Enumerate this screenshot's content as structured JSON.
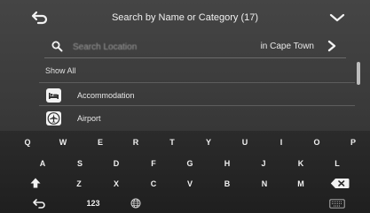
{
  "header": {
    "title": "Search by Name or Category (17)",
    "back_icon": "back-arrow-icon",
    "collapse_icon": "chevron-down-icon"
  },
  "search": {
    "placeholder": "Search Location",
    "location": "in Cape Town",
    "search_icon": "search-icon",
    "location_arrow_icon": "chevron-right-icon"
  },
  "list": {
    "show_all": "Show All",
    "items": [
      {
        "label": "Accommodation",
        "icon": "bed-icon"
      },
      {
        "label": "Airport",
        "icon": "airplane-icon"
      }
    ]
  },
  "keyboard": {
    "row1": [
      "Q",
      "W",
      "E",
      "R",
      "T",
      "Y",
      "U",
      "I",
      "O",
      "P"
    ],
    "row2": [
      "A",
      "S",
      "D",
      "F",
      "G",
      "H",
      "J",
      "K",
      "L"
    ],
    "row3": [
      "Z",
      "X",
      "C",
      "V",
      "B",
      "N",
      "M"
    ],
    "numbers_label": "123",
    "shift_icon": "shift-icon",
    "backspace_icon": "backspace-icon",
    "return_icon": "return-icon",
    "globe_icon": "globe-icon",
    "space_icon": "space-icon",
    "hide_keyboard_icon": "keyboard-hide-icon"
  }
}
